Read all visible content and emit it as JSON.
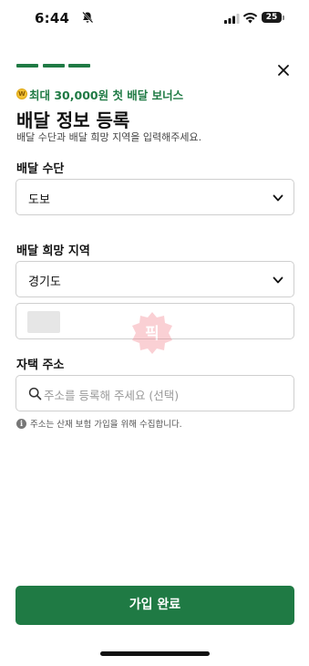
{
  "status_bar": {
    "time": "6:44",
    "battery": "25",
    "icons": [
      "bell-off-icon",
      "signal-icon",
      "wifi-icon",
      "battery-icon"
    ]
  },
  "header": {
    "progress_steps": 3,
    "close_icon": "close-icon"
  },
  "bonus": {
    "coin_symbol": "W",
    "text": "최대 30,000원 첫 배달 보너스",
    "color": "#1f7a44"
  },
  "title": "배달 정보 등록",
  "subtitle": "배달 수단과 배달 희망 지역을 입력해주세요.",
  "delivery_method": {
    "label": "배달 수단",
    "value": "도보"
  },
  "delivery_region": {
    "label": "배달 희망 지역",
    "value": "경기도",
    "sub_value": ""
  },
  "home_address": {
    "label": "자택 주소",
    "placeholder": "주소를 등록해 주세요 (선택)"
  },
  "info_note": {
    "icon": "i",
    "text": "주소는 산재 보험 가입을 위해 수집합니다."
  },
  "watermark_text": "픽",
  "submit": {
    "label": "가입 완료",
    "color": "#1f7a44"
  }
}
